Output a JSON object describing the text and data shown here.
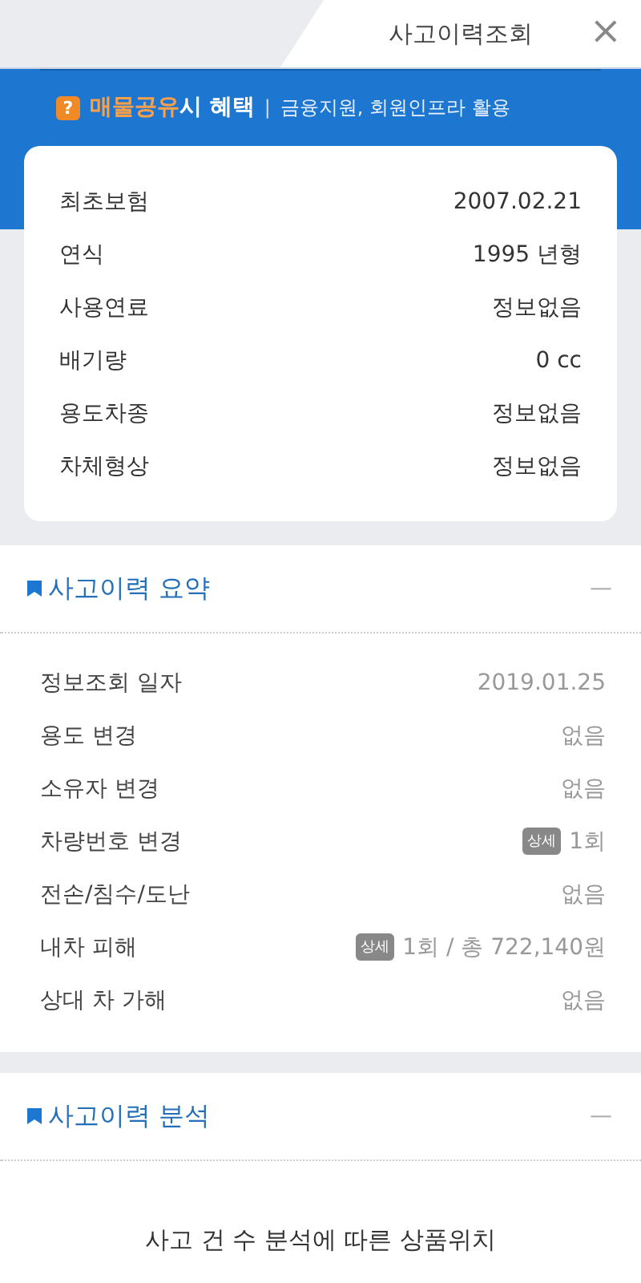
{
  "window": {
    "title": "사고이력조회",
    "close": "×"
  },
  "banner": {
    "badge": "?",
    "highlight": "매물공유",
    "emphasis": "시 혜택",
    "separator": "|",
    "text": "금융지원, 회원인프라 활용"
  },
  "car_info": [
    {
      "label": "최초보험",
      "value": "2007.02.21"
    },
    {
      "label": "연식",
      "value": "1995 년형"
    },
    {
      "label": "사용연료",
      "value": "정보없음"
    },
    {
      "label": "배기량",
      "value": "0 cc"
    },
    {
      "label": "용도차종",
      "value": "정보없음"
    },
    {
      "label": "차체형상",
      "value": "정보없음"
    }
  ],
  "summary": {
    "title": "사고이력 요약",
    "collapse": "—",
    "rows": [
      {
        "label": "정보조회 일자",
        "value": "2019.01.25"
      },
      {
        "label": "용도 변경",
        "value": "없음"
      },
      {
        "label": "소유자 변경",
        "value": "없음"
      },
      {
        "label": "차량번호 변경",
        "tag": "상세",
        "value": "1회"
      },
      {
        "label": "전손/침수/도난",
        "value": "없음"
      },
      {
        "label": "내차 피해",
        "tag": "상세",
        "value": "1회 / 총 722,140원"
      },
      {
        "label": "상대 차 가해",
        "value": "없음"
      }
    ]
  },
  "analysis": {
    "title": "사고이력 분석",
    "collapse": "—",
    "subtitle": "사고 건 수 분석에 따른 상품위치"
  }
}
